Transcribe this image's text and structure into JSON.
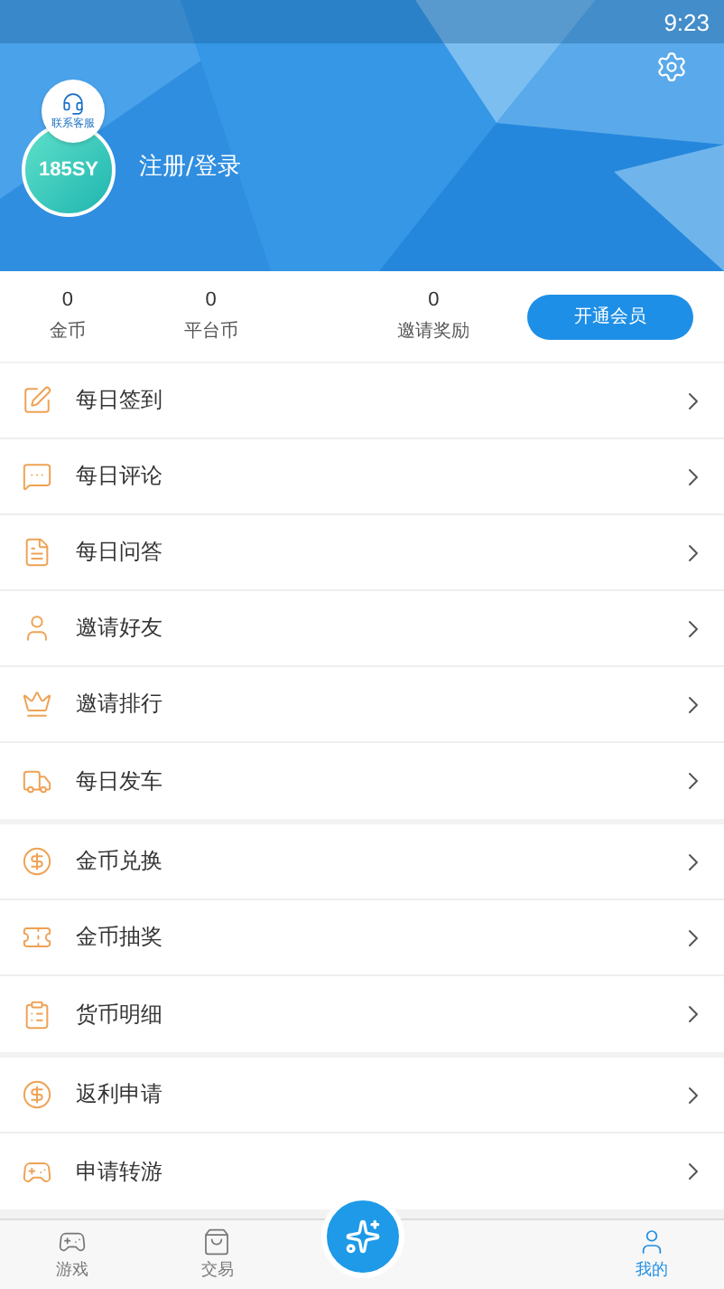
{
  "status_bar": {
    "time": "9:23"
  },
  "profile": {
    "support_badge": "联系客服",
    "avatar_logo": "185SY",
    "login_link": "注册/登录"
  },
  "stats": [
    {
      "value": "0",
      "label": "金币"
    },
    {
      "value": "0",
      "label": "平台币"
    },
    {
      "value": "0",
      "label": "邀请奖励"
    }
  ],
  "vip_button": "开通会员",
  "menu_groups": [
    [
      {
        "label": "每日签到"
      },
      {
        "label": "每日评论"
      },
      {
        "label": "每日问答"
      },
      {
        "label": "邀请好友"
      },
      {
        "label": "邀请排行"
      },
      {
        "label": "每日发车"
      }
    ],
    [
      {
        "label": "金币兑换"
      },
      {
        "label": "金币抽奖"
      },
      {
        "label": "货币明细"
      }
    ],
    [
      {
        "label": "返利申请"
      },
      {
        "label": "申请转游"
      }
    ]
  ],
  "bottom_nav": [
    {
      "kind": "tab",
      "label": "游戏",
      "selected": false
    },
    {
      "kind": "tab",
      "label": "交易",
      "selected": false
    },
    {
      "kind": "center"
    },
    {
      "kind": "empty"
    },
    {
      "kind": "tab",
      "label": "我的",
      "selected": true
    }
  ]
}
